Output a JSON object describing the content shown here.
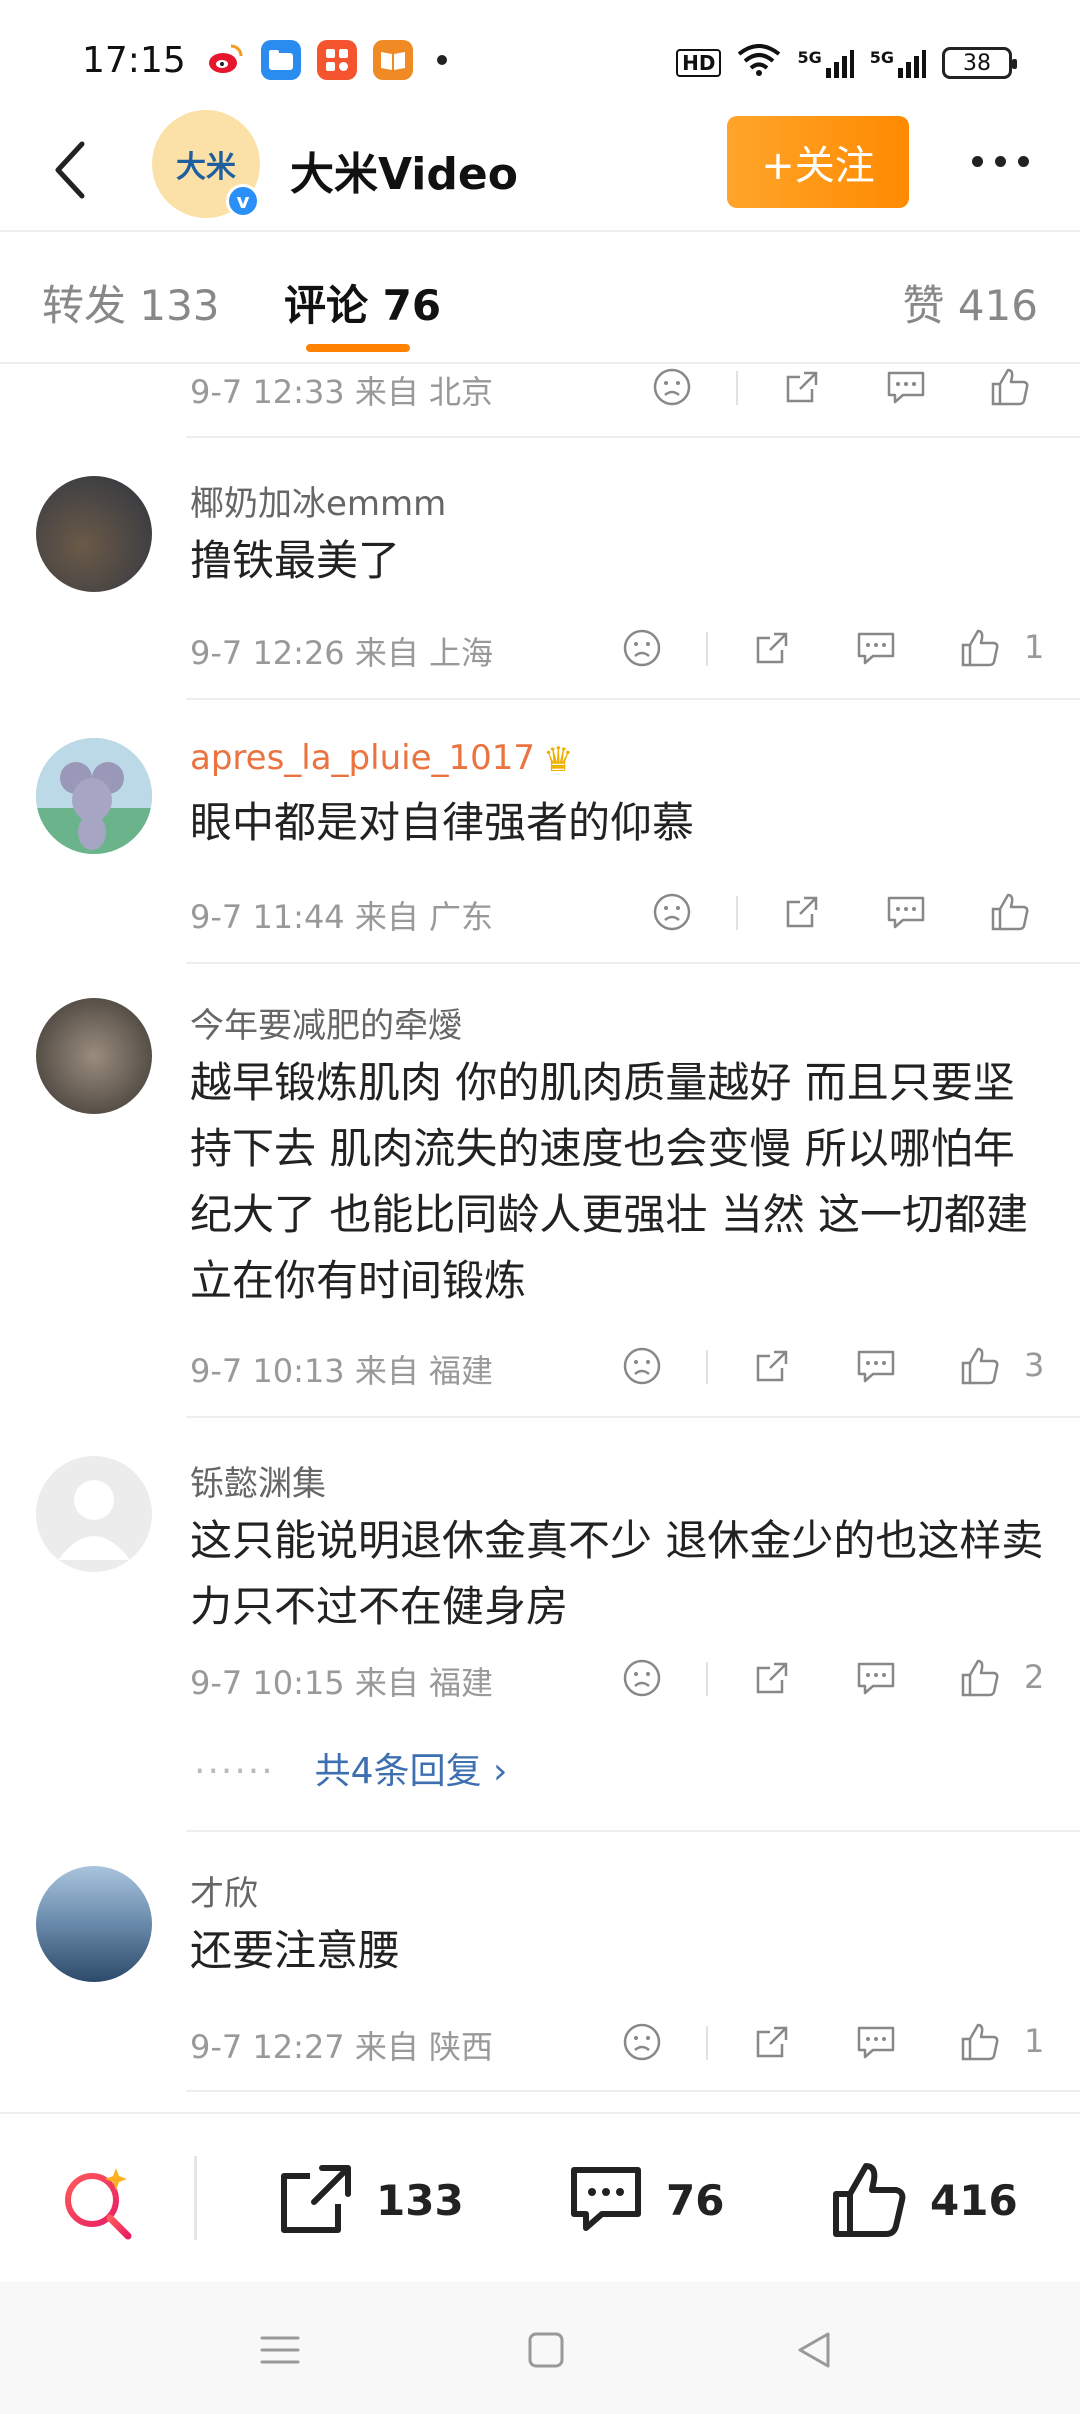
{
  "status_bar": {
    "time": "17:15",
    "network1": "5G",
    "network2": "5G",
    "hd": "HD",
    "battery": "38"
  },
  "header": {
    "account_name": "大米Video",
    "logo_text": "大米",
    "follow_label": "+关注"
  },
  "tabs": [
    {
      "label": "转发 133"
    },
    {
      "label": "评论 76"
    },
    {
      "label": "赞 416"
    }
  ],
  "top_partial_comment": {
    "meta": "9-7 12:33  来自 北京"
  },
  "comments": [
    {
      "username": "椰奶加冰emmm",
      "text": "撸铁最美了",
      "meta": "9-7 12:26  来自 上海",
      "likes": "1"
    },
    {
      "username": "apres_la_pluie_1017",
      "text": "眼中都是对自律强者的仰慕",
      "meta": "9-7 11:44  来自 广东",
      "likes": ""
    },
    {
      "username": "今年要减肥的牵燰",
      "text": "越早锻炼肌肉 你的肌肉质量越好 而且只要坚持下去 肌肉流失的速度也会变慢 所以哪怕年纪大了 也能比同龄人更强壮 当然 这一切都建立在你有时间锻炼",
      "meta": "9-7 10:13  来自 福建",
      "likes": "3"
    },
    {
      "username": "铄懿渊集",
      "text": "这只能说明退休金真不少 退休金少的也这样卖力只不过不在健身房",
      "meta": "9-7 10:15  来自 福建",
      "likes": "2",
      "replies": "共4条回复 ›"
    },
    {
      "username": "才欣",
      "text": "还要注意腰",
      "meta": "9-7 12:27  来自 陕西",
      "likes": "1"
    }
  ],
  "bottom_bar": {
    "repost_count": "133",
    "comment_count": "76",
    "like_count": "416"
  },
  "colors": {
    "accent_orange": "#ff8200",
    "vip_username": "#eb7340",
    "link_blue": "#3e6fb0"
  }
}
